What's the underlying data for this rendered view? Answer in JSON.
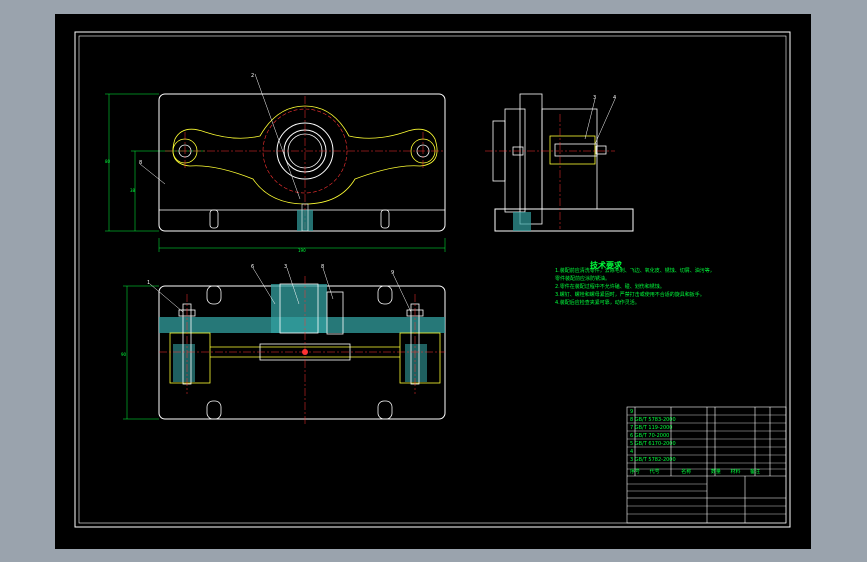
{
  "colors": {
    "background": "#000000",
    "frame": "#ffffff",
    "outline": "#ffffff",
    "centerline": "#ff3333",
    "hidden": "#ffff33",
    "hatch": "#33a0a0",
    "text_green": "#00ff3c",
    "dims": "#00ff3c"
  },
  "tech_requirements": {
    "title": "技术要求",
    "lines": [
      "1.装配前应清洗零件，去除毛刺、飞边、氧化皮、锈蚀、切屑、油污等，",
      "  零件装配前应涂防锈油。",
      "2.零件在装配过程中不允许磕、碰、划伤和锈蚀。",
      "3.螺钉、螺栓和螺母紧固时，严禁打击或使用不合适的旋具和扳手。",
      "4.装配后应检查夹紧可靠，动作灵活。"
    ]
  },
  "balloons": {
    "top_view": [
      "2",
      "8"
    ],
    "side_view": [
      "3",
      "4"
    ],
    "section_view": [
      "1",
      "6",
      "3",
      "8",
      "9"
    ]
  },
  "bom": {
    "header": [
      "序号",
      "代号",
      "名称",
      "数量",
      "材料",
      "备注"
    ],
    "rows": [
      [
        "9",
        "",
        "",
        "1",
        "",
        ""
      ],
      [
        "8",
        "GB/T 5783-2000",
        "",
        "2",
        "",
        ""
      ],
      [
        "7",
        "GB/T 119-2000",
        "",
        "1",
        "",
        ""
      ],
      [
        "6",
        "GB/T 70-2000",
        "",
        "1",
        "",
        ""
      ],
      [
        "5",
        "GB/T 6170-2000",
        "",
        "1",
        "",
        ""
      ],
      [
        "4",
        "",
        "",
        "1",
        "",
        ""
      ],
      [
        "3",
        "GB/T 5782-2000",
        "",
        "2",
        "",
        ""
      ],
      [
        "2",
        "",
        "",
        "1",
        "",
        ""
      ],
      [
        "1",
        "",
        "",
        "1",
        "",
        ""
      ]
    ]
  }
}
